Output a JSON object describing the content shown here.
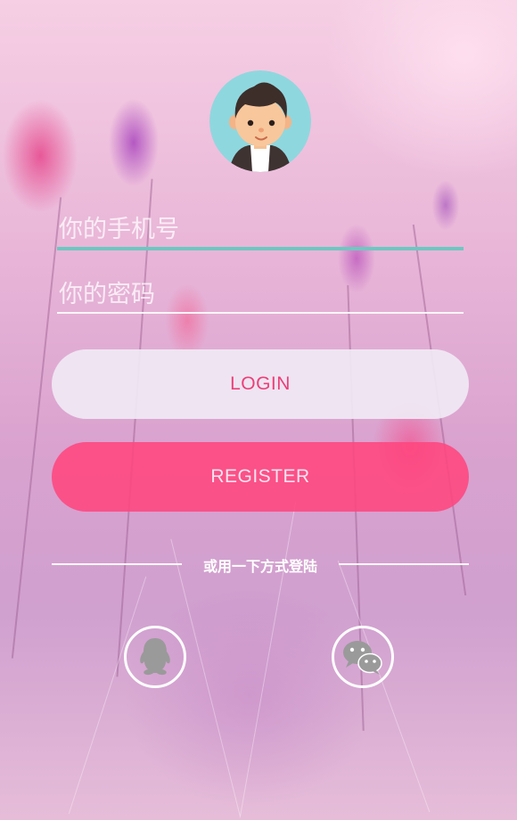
{
  "login_form": {
    "phone_placeholder": "你的手机号",
    "password_placeholder": "你的密码",
    "login_label": "LOGIN",
    "register_label": "REGISTER"
  },
  "alt_login": {
    "divider_text": "或用一下方式登陆",
    "options": [
      {
        "icon": "qq-icon"
      },
      {
        "icon": "wechat-icon"
      }
    ]
  },
  "colors": {
    "active_underline": "#6ec7c0",
    "login_text": "#ec3f78",
    "register_bg": "#ff467e",
    "icon_gray": "#9a9a9a"
  }
}
